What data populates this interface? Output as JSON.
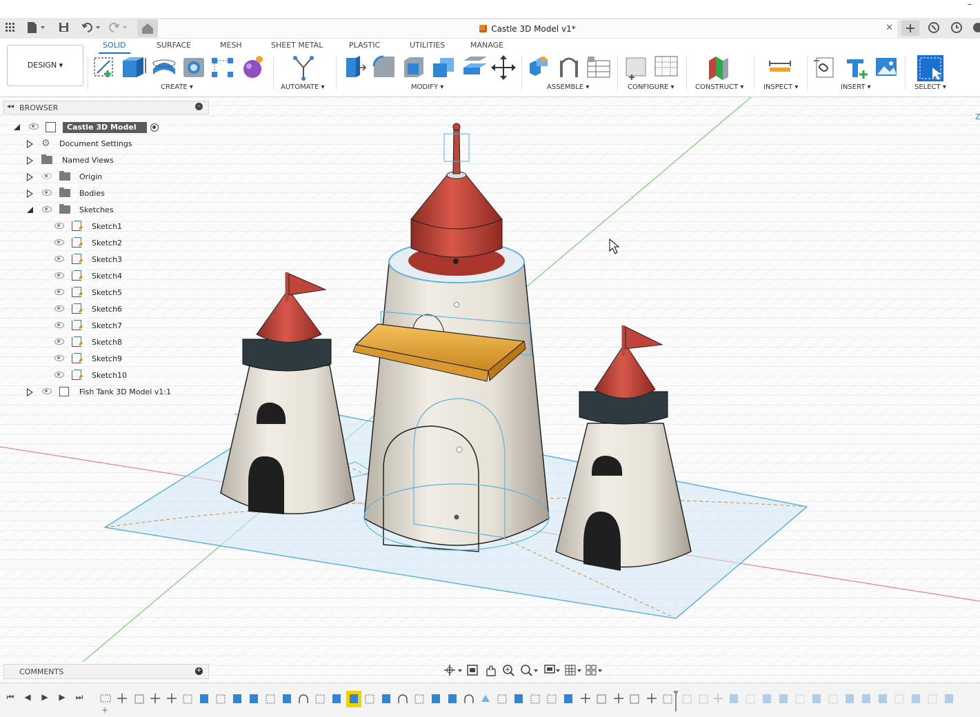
{
  "window": {
    "title": "Castle 3D Model v1*",
    "minimize": "–"
  },
  "titlebar_icons": [
    "grid-icon",
    "file-icon",
    "save-icon",
    "undo-icon",
    "redo-icon",
    "home-icon"
  ],
  "titlebar_right_icons": [
    "new-tab-icon",
    "extensions-icon",
    "history-icon",
    "notification-icon"
  ],
  "ribbon": {
    "workspace": "DESIGN ▾",
    "tabs": [
      {
        "label": "SOLID",
        "active": true
      },
      {
        "label": "SURFACE"
      },
      {
        "label": "MESH"
      },
      {
        "label": "SHEET METAL"
      },
      {
        "label": "PLASTIC"
      },
      {
        "label": "UTILITIES"
      },
      {
        "label": "MANAGE"
      }
    ],
    "groups": {
      "create": "CREATE ▾",
      "automate": "AUTOMATE ▾",
      "modify": "MODIFY ▾",
      "assemble": "ASSEMBLE ▾",
      "configure": "CONFIGURE ▾",
      "construct": "CONSTRUCT ▾",
      "inspect": "INSPECT ▾",
      "insert": "INSERT ▾",
      "select": "SELECT ▾"
    }
  },
  "browser": {
    "title": "BROWSER",
    "root": "Castle 3D Model v1",
    "items": [
      {
        "label": "Document Settings"
      },
      {
        "label": "Named Views"
      },
      {
        "label": "Origin"
      },
      {
        "label": "Bodies"
      },
      {
        "label": "Sketches"
      }
    ],
    "sketches": [
      "Sketch1",
      "Sketch2",
      "Sketch3",
      "Sketch4",
      "Sketch5",
      "Sketch6",
      "Sketch7",
      "Sketch8",
      "Sketch9",
      "Sketch10"
    ],
    "linked": "Fish Tank 3D Model v1:1"
  },
  "comments": {
    "title": "COMMENTS"
  },
  "colors": {
    "accent": "#1a6fd0",
    "roof": "#c0443a",
    "wall": "#ebe6dc",
    "sketch": "#5bb4e0",
    "balcony": "#e8a32a"
  }
}
